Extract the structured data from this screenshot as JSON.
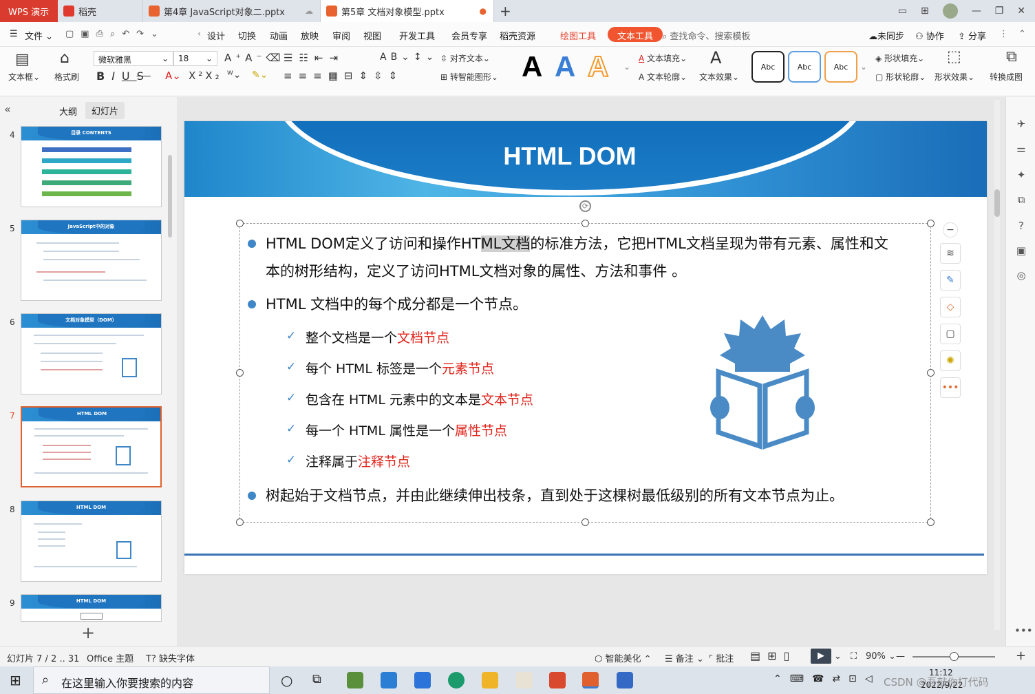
{
  "tabs": {
    "app": "WPS 演示",
    "items": [
      {
        "label": "稻壳"
      },
      {
        "label": "第4章 JavaScript对象二.pptx"
      },
      {
        "label": "第5章 文档对象模型.pptx"
      }
    ]
  },
  "menu": {
    "file": "文件",
    "items": [
      "设计",
      "切换",
      "动画",
      "放映",
      "审阅",
      "视图",
      "开发工具",
      "会员专享",
      "稻壳资源"
    ],
    "drawing_tools": "绘图工具",
    "text_tools": "文本工具",
    "search": "查找命令、搜索模板",
    "sync": "未同步",
    "collab": "协作",
    "share": "分享"
  },
  "ribbon": {
    "textbox": "文本框",
    "format_brush": "格式刷",
    "font": "微软雅黑",
    "size": "18",
    "align_text": "对齐文本",
    "smart_shape": "转智能图形",
    "text_fill": "文本填充",
    "text_outline": "文本轮廓",
    "text_effect": "文本效果",
    "abc": [
      "Abc",
      "Abc",
      "Abc"
    ],
    "shape_fill": "形状填充",
    "shape_outline": "形状轮廓",
    "shape_effect": "形状效果",
    "convert": "转换成图"
  },
  "panel": {
    "outline": "大纲",
    "slides": "幻灯片",
    "thumbs": [
      {
        "num": "4",
        "title": "目录  CONTENTS"
      },
      {
        "num": "5",
        "title": "JavaScript中的对象"
      },
      {
        "num": "6",
        "title": "文档对象模型（DOM）"
      },
      {
        "num": "7",
        "title": "HTML DOM"
      },
      {
        "num": "8",
        "title": "HTML DOM"
      },
      {
        "num": "9",
        "title": "HTML DOM"
      }
    ],
    "add": "+"
  },
  "slide": {
    "title": "HTML DOM",
    "p1_a": "HTML DOM定义了访问和操作HT",
    "p1_hl": "ML文档",
    "p1_b": "的标准方法，它把HTML文档呈现为带有元素、属性和文",
    "p1_line2": "本的树形结构，定义了访问HTML文档对象的属性、方法和事件 。",
    "p2": "HTML 文档中的每个成分都是一个节点。",
    "subs": [
      {
        "text": "整个文档是一个",
        "red": "文档节点"
      },
      {
        "text": "每个 HTML 标签是一个",
        "red": "元素节点"
      },
      {
        "text": "包含在 HTML 元素中的文本是",
        "red": "文本节点"
      },
      {
        "text": "每一个 HTML 属性是一个",
        "red": "属性节点"
      },
      {
        "text": "注释属于",
        "red": "注释节点"
      }
    ],
    "p3": "树起始于文档节点，并由此继续伸出枝条，直到处于这棵树最低级别的所有文本节点为止。"
  },
  "status": {
    "slide_info": "幻灯片 7 / 2 .. 31",
    "theme": "Office 主题",
    "missing_font": "缺失字体",
    "beautify": "智能美化",
    "notes": "备注",
    "comments": "批注",
    "zoom": "90%"
  },
  "taskbar": {
    "search_placeholder": "在这里输入你要搜索的内容",
    "time": "11:12",
    "date": "2022/9/22",
    "watermark": "CSDN @吾敲你打代码"
  },
  "colors": {
    "accent": "#f0552f",
    "wps_red": "#d93c2e",
    "slide_blue": "#1f75c0",
    "bullet_blue": "#3f87c7",
    "highlight_red": "#e0241b"
  }
}
